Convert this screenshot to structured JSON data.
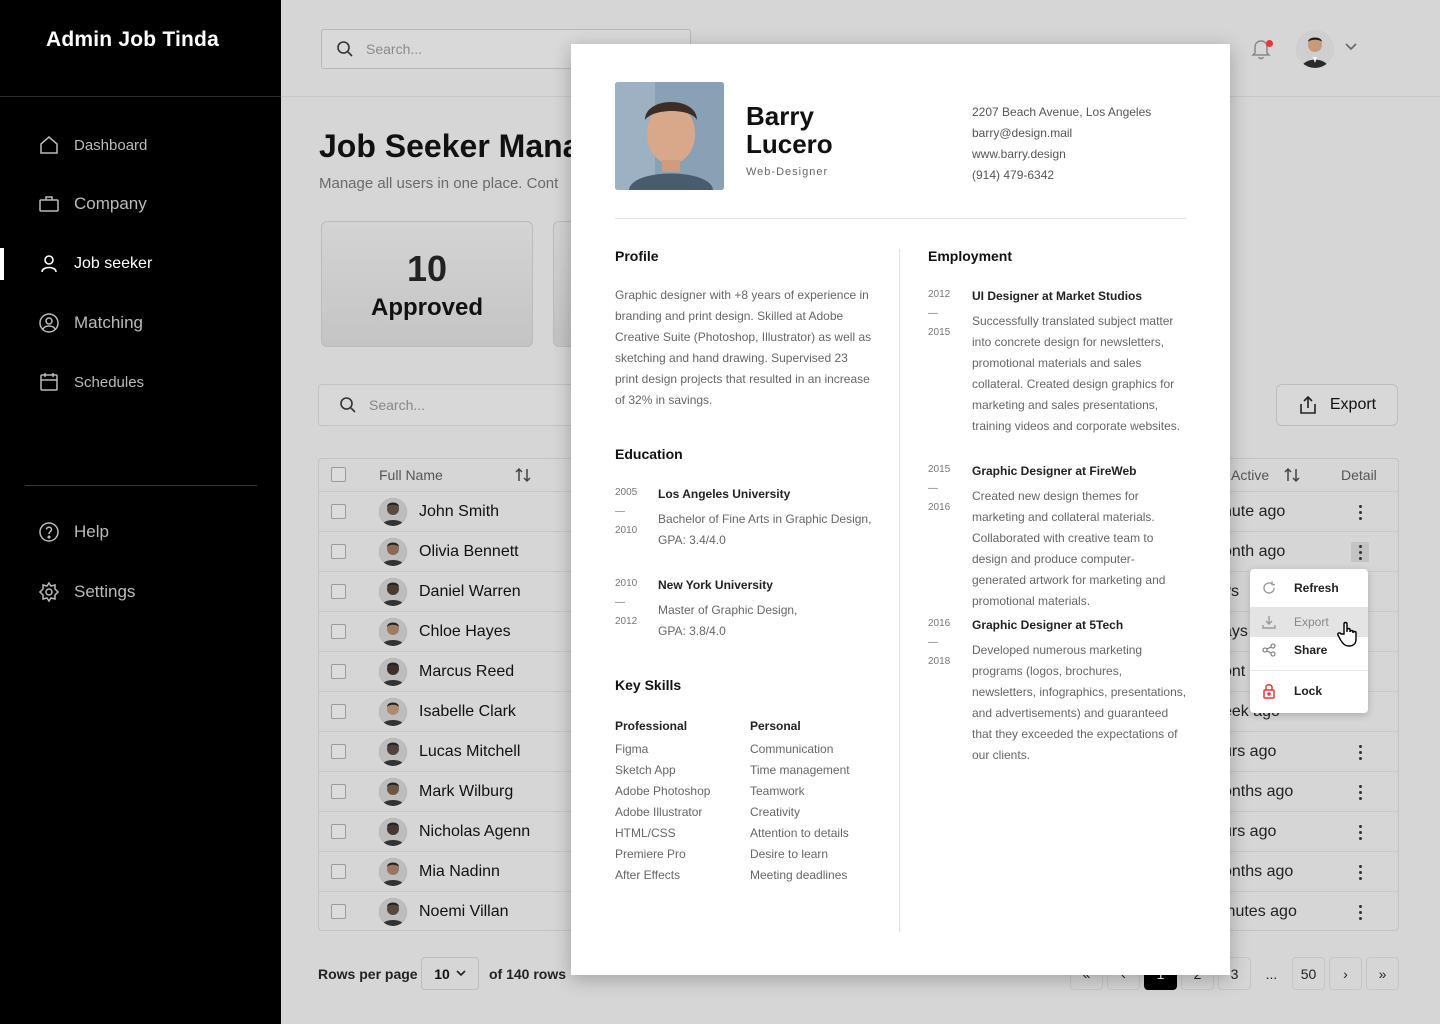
{
  "app": {
    "title": "Admin Job Tinda"
  },
  "sidebar": {
    "items": [
      {
        "label": "Dashboard",
        "icon": "home-icon"
      },
      {
        "label": "Company",
        "icon": "briefcase-icon"
      },
      {
        "label": "Job seeker",
        "icon": "user-icon"
      },
      {
        "label": "Matching",
        "icon": "matching-icon"
      },
      {
        "label": "Schedules",
        "icon": "calendar-icon"
      }
    ],
    "bottom_items": [
      {
        "label": "Help",
        "icon": "help-icon"
      },
      {
        "label": "Settings",
        "icon": "gear-icon"
      }
    ]
  },
  "header": {
    "search_placeholder": "Search..."
  },
  "main": {
    "title": "Job Seeker Mana",
    "subtitle": "Manage all users in one place. Cont",
    "stats": [
      {
        "value": "10",
        "label": "Approved"
      }
    ],
    "table_search_placeholder": "Search...",
    "export_label": "Export",
    "columns": {
      "full_name": "Full Name",
      "active": "Active",
      "detail": "Detail"
    },
    "rows": [
      {
        "name": "John Smith",
        "active": "nute ago"
      },
      {
        "name": "Olivia Bennett",
        "active": "onth ago"
      },
      {
        "name": "Daniel Warren",
        "active": "ys"
      },
      {
        "name": "Chloe Hayes",
        "active": "ays"
      },
      {
        "name": "Marcus Reed",
        "active": "ont"
      },
      {
        "name": "Isabelle Clark",
        "active": "eek ago"
      },
      {
        "name": "Lucas Mitchell",
        "active": "urs ago"
      },
      {
        "name": "Mark Wilburg",
        "active": "onths ago"
      },
      {
        "name": "Nicholas Agenn",
        "active": "urs ago"
      },
      {
        "name": "Mia Nadinn",
        "active": "onths ago"
      },
      {
        "name": "Noemi Villan",
        "active": "inutes ago"
      }
    ]
  },
  "footer": {
    "rows_per_page_label": "Rows per page",
    "rows_per_page_value": "10",
    "of_rows": "of 140 rows",
    "pages": [
      "1",
      "2",
      "3",
      "...",
      "50"
    ],
    "first": "«",
    "prev": "‹",
    "next": "›",
    "last": "»"
  },
  "resume": {
    "first_name": "Barry",
    "last_name": "Lucero",
    "role": "Web-Designer",
    "contact": [
      "2207 Beach Avenue, Los Angeles",
      "barry@design.mail",
      "www.barry.design",
      "(914) 479-6342"
    ],
    "profile_heading": "Profile",
    "profile_text": "Graphic designer with +8 years of experience in branding and print design. Skilled at Adobe Creative Suite (Photoshop, Illustrator) as well as sketching and hand drawing. Supervised 23 print design projects that resulted in an increase of 32% in savings.",
    "education_heading": "Education",
    "education": [
      {
        "start": "2005",
        "end": "2010",
        "school": "Los Angeles University",
        "detail": "Bachelor of Fine Arts in Graphic Design, GPA: 3.4/4.0"
      },
      {
        "start": "2010",
        "end": "2012",
        "school": "New York University",
        "detail": "Master of Graphic Design, GPA: 3.8/4.0"
      }
    ],
    "skills_heading": "Key Skills",
    "professional_heading": "Professional",
    "professional": [
      "Figma",
      "Sketch App",
      "Adobe Photoshop",
      "Adobe Illustrator",
      "HTML/CSS",
      "Premiere Pro",
      "After Effects"
    ],
    "personal_heading": "Personal",
    "personal": [
      "Communication",
      "Time management",
      "Teamwork",
      "Creativity",
      "Attention to details",
      "Desire to learn",
      "Meeting deadlines"
    ],
    "employment_heading": "Employment",
    "employment": [
      {
        "start": "2012",
        "end": "2015",
        "title": "UI Designer at Market Studios",
        "detail": "Successfully translated subject matter into concrete design for newsletters, promotional materials and sales collateral. Created design graphics for marketing and sales presentations, training videos and corporate websites."
      },
      {
        "start": "2015",
        "end": "2016",
        "title": "Graphic Designer at FireWeb",
        "detail": "Created new design themes for marketing and collateral materials. Collaborated with creative team to design and produce computer-generated artwork for marketing and promotional materials."
      },
      {
        "start": "2016",
        "end": "2018",
        "title": "Graphic Designer at 5Tech",
        "detail": "Developed numerous marketing programs (logos, brochures, newsletters, infographics, presentations, and advertisements) and guaranteed that they exceeded the expectations of our clients."
      }
    ]
  },
  "context_menu": {
    "items": [
      {
        "label": "Refresh",
        "icon": "refresh-icon"
      },
      {
        "label": "Export",
        "icon": "download-icon"
      },
      {
        "label": "Share",
        "icon": "share-icon"
      },
      {
        "label": "Lock",
        "icon": "lock-icon"
      }
    ]
  },
  "colors": {
    "sidebar": "#000000",
    "accent": "#000000",
    "lock": "#e53935",
    "notification": "#e53935"
  }
}
